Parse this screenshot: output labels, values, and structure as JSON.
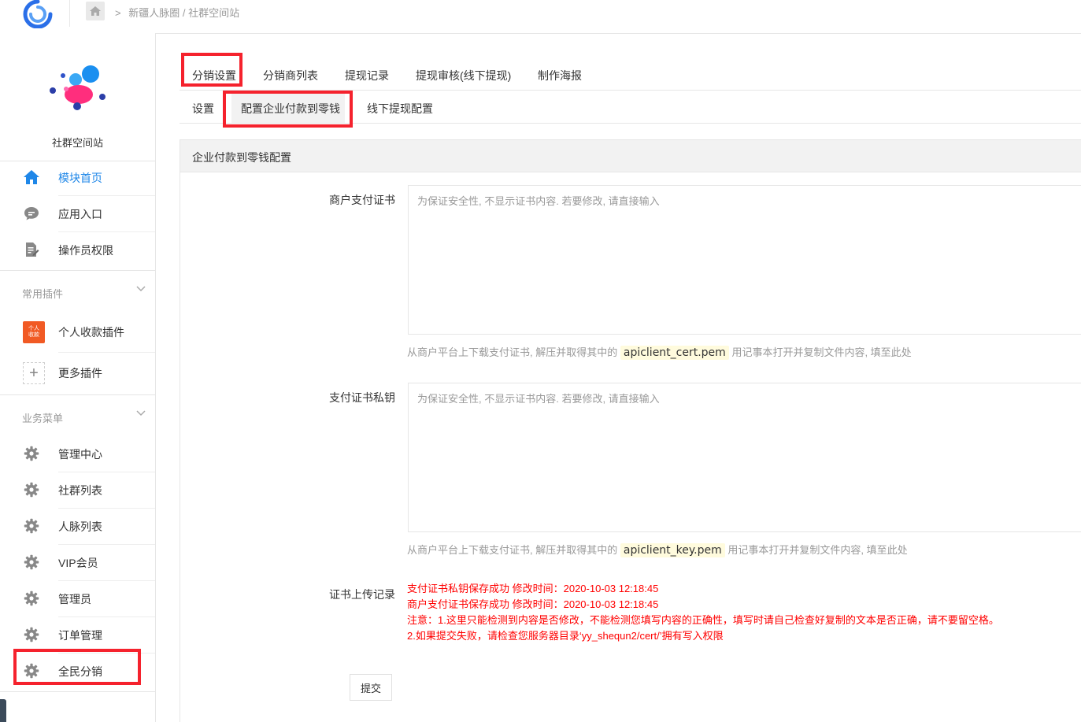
{
  "breadcrumb": {
    "items": [
      "新疆人脉圈",
      "社群空间站"
    ],
    "separator": "/"
  },
  "sidebar": {
    "brand_name": "社群空间站",
    "items": [
      {
        "label": "模块首页",
        "icon": "home-icon",
        "active": true
      },
      {
        "label": "应用入口",
        "icon": "chat-bubble-icon"
      },
      {
        "label": "操作员权限",
        "icon": "document-edit-icon"
      }
    ],
    "groups": [
      {
        "title": "常用插件",
        "items": [
          {
            "label": "个人收款插件",
            "icon": "personal-payment-plugin-icon",
            "badge_lines": [
              "个人",
              "收款"
            ]
          },
          {
            "label": "更多插件",
            "icon": "plus-icon",
            "glyph": "+"
          }
        ]
      },
      {
        "title": "业务菜单",
        "items": [
          {
            "label": "管理中心",
            "icon": "gear-icon"
          },
          {
            "label": "社群列表",
            "icon": "gear-icon"
          },
          {
            "label": "人脉列表",
            "icon": "gear-icon"
          },
          {
            "label": "VIP会员",
            "icon": "gear-icon"
          },
          {
            "label": "管理员",
            "icon": "gear-icon"
          },
          {
            "label": "订单管理",
            "icon": "gear-icon"
          },
          {
            "label": "全民分销",
            "icon": "gear-icon"
          }
        ]
      }
    ]
  },
  "tabs_primary": [
    "分销设置",
    "分销商列表",
    "提现记录",
    "提现审核(线下提现)",
    "制作海报"
  ],
  "tabs_secondary": [
    "设置",
    "配置企业付款到零钱",
    "线下提现配置"
  ],
  "panel": {
    "title": "企业付款到零钱配置",
    "fields": [
      {
        "label": "商户支付证书",
        "placeholder": "为保证安全性, 不显示证书内容. 若要修改, 请直接输入",
        "help_prefix": "从商户平台上下载支付证书, 解压并取得其中的",
        "help_code": "apiclient_cert.pem",
        "help_suffix": "用记事本打开并复制文件内容, 填至此处"
      },
      {
        "label": "支付证书私钥",
        "placeholder": "为保证安全性, 不显示证书内容. 若要修改, 请直接输入",
        "help_prefix": "从商户平台上下载支付证书, 解压并取得其中的",
        "help_code": "apiclient_key.pem",
        "help_suffix": "用记事本打开并复制文件内容, 填至此处"
      }
    ],
    "record_label": "证书上传记录",
    "record_lines": [
      "支付证书私钥保存成功 修改时间：2020-10-03 12:18:45",
      "商户支付证书保存成功 修改时间：2020-10-03 12:18:45",
      "注意：1.这里只能检测到内容是否修改，不能检测您填写内容的正确性，填写时请自己检查好复制的文本是否正确，请不要留空格。",
      "2.如果提交失败，请检查您服务器目录‘yy_shequn2/cert/’拥有写入权限"
    ],
    "submit_label": "提交"
  },
  "colors": {
    "accent": "#1f87e8",
    "highlight": "#f5222d",
    "error_text": "#ff0000"
  }
}
